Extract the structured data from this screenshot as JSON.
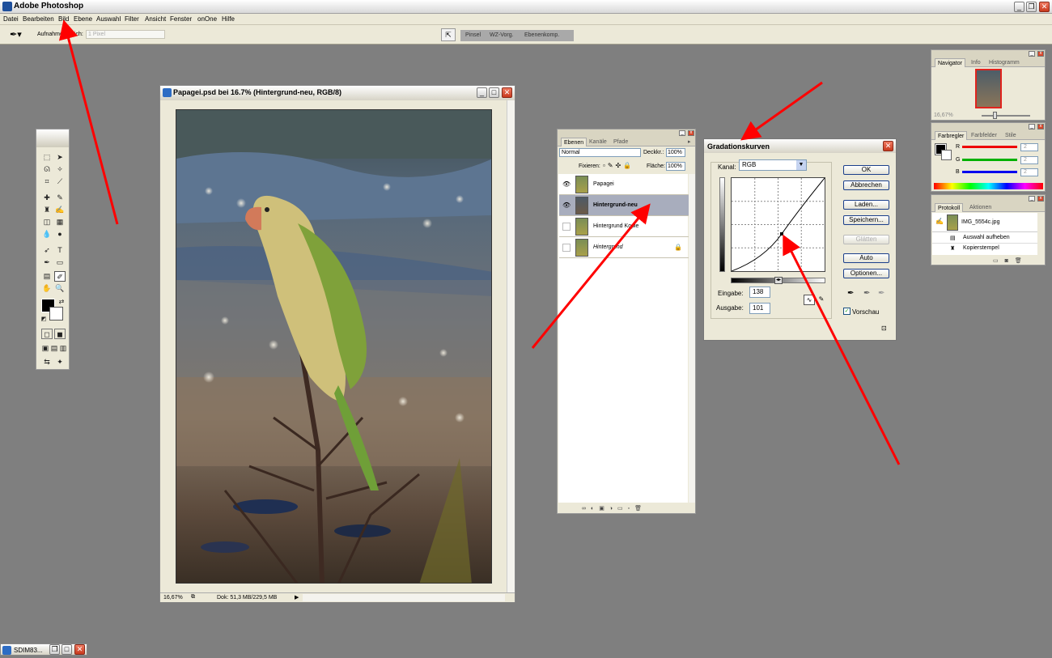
{
  "app": {
    "title": "Adobe Photoshop"
  },
  "menu": [
    "Datei",
    "Bearbeiten",
    "Bild",
    "Ebene",
    "Auswahl",
    "Filter",
    "Ansicht",
    "Fenster",
    "onOne",
    "Hilfe"
  ],
  "options_bar": {
    "sample_label": "Aufnahmebereich:",
    "sample_value": "1 Pixel",
    "palette_tabs": [
      "Pinsel",
      "WZ-Vorg.",
      "Ebenenkomp."
    ]
  },
  "document": {
    "title": "Papagei.psd bei 16.7% (Hintergrund-neu, RGB/8)",
    "zoom": "16,67%",
    "doc_size": "Dok: 51,3 MB/229,5 MB"
  },
  "layers_panel": {
    "tabs": [
      "Ebenen",
      "Kanäle",
      "Pfade"
    ],
    "blend_mode": "Normal",
    "opacity_label": "Deckkr.:",
    "opacity": "100%",
    "lock_label": "Fixieren:",
    "fill_label": "Fläche:",
    "fill": "100%",
    "layers": [
      {
        "name": "Papagei",
        "visible": true,
        "selected": false
      },
      {
        "name": "Hintergrund-neu",
        "visible": true,
        "selected": true
      },
      {
        "name": "Hintergrund Kopie",
        "visible": false,
        "selected": false
      },
      {
        "name": "Hintergrund",
        "visible": false,
        "selected": false
      }
    ]
  },
  "curves_dialog": {
    "title": "Gradationskurven",
    "channel_label": "Kanal:",
    "channel": "RGB",
    "input_label": "Eingabe:",
    "input": "138",
    "output_label": "Ausgabe:",
    "output": "101",
    "preview_label": "Vorschau",
    "buttons": {
      "ok": "OK",
      "cancel": "Abbrechen",
      "load": "Laden...",
      "save": "Speichern...",
      "smooth": "Glätten",
      "auto": "Auto",
      "options": "Optionen..."
    }
  },
  "navigator_panel": {
    "tabs": [
      "Navigator",
      "Info",
      "Histogramm"
    ],
    "zoom": "16,67%"
  },
  "color_panel": {
    "tabs": [
      "Farbregler",
      "Farbfelder",
      "Stile"
    ],
    "channels": [
      {
        "label": "R",
        "value": "2",
        "color": "#ff0000"
      },
      {
        "label": "G",
        "value": "2",
        "color": "#00b000"
      },
      {
        "label": "B",
        "value": "2",
        "color": "#0000ff"
      }
    ]
  },
  "history_panel": {
    "tabs": [
      "Protokoll",
      "Aktionen"
    ],
    "snapshot": "IMG_5554c.jpg",
    "steps": [
      "Auswahl aufheben",
      "Kopierstempel"
    ]
  },
  "taskbar": {
    "minimized_doc": "SDIM83..."
  },
  "colors": {
    "annotation_arrow": "#ff0000",
    "selection_highlight": "#a8adbd",
    "workspace": "#7f7f7f"
  }
}
